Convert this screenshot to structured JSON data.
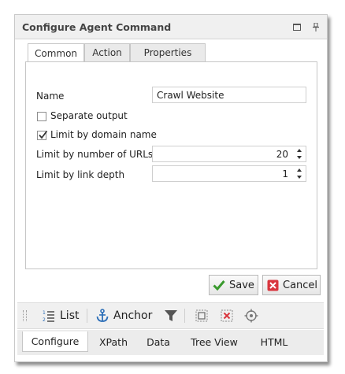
{
  "window": {
    "title": "Configure Agent Command",
    "restore_icon": "restore-icon",
    "pin_icon": "pin-icon"
  },
  "tabs": [
    {
      "label": "Common",
      "active": true
    },
    {
      "label": "Action",
      "active": false
    },
    {
      "label": "Properties",
      "active": false
    }
  ],
  "form": {
    "name_label": "Name",
    "name_value": "Crawl Website",
    "separate_output_label": "Separate output",
    "separate_output_checked": false,
    "limit_domain_label": "Limit by domain name",
    "limit_domain_checked": true,
    "limit_urls_label": "Limit by number of URLs",
    "limit_urls_value": "20",
    "limit_depth_label": "Limit by link depth",
    "limit_depth_value": "1"
  },
  "buttons": {
    "save_label": "Save",
    "cancel_label": "Cancel"
  },
  "toolbar": {
    "list_label": "List",
    "anchor_label": "Anchor"
  },
  "bottom_tabs": [
    {
      "label": "Configure",
      "active": true
    },
    {
      "label": "XPath",
      "active": false
    },
    {
      "label": "Data",
      "active": false
    },
    {
      "label": "Tree View",
      "active": false
    },
    {
      "label": "HTML",
      "active": false
    }
  ],
  "colors": {
    "check_green": "#3a9a2e",
    "cancel_red": "#d9363e",
    "anchor_blue": "#2d6fb8"
  }
}
